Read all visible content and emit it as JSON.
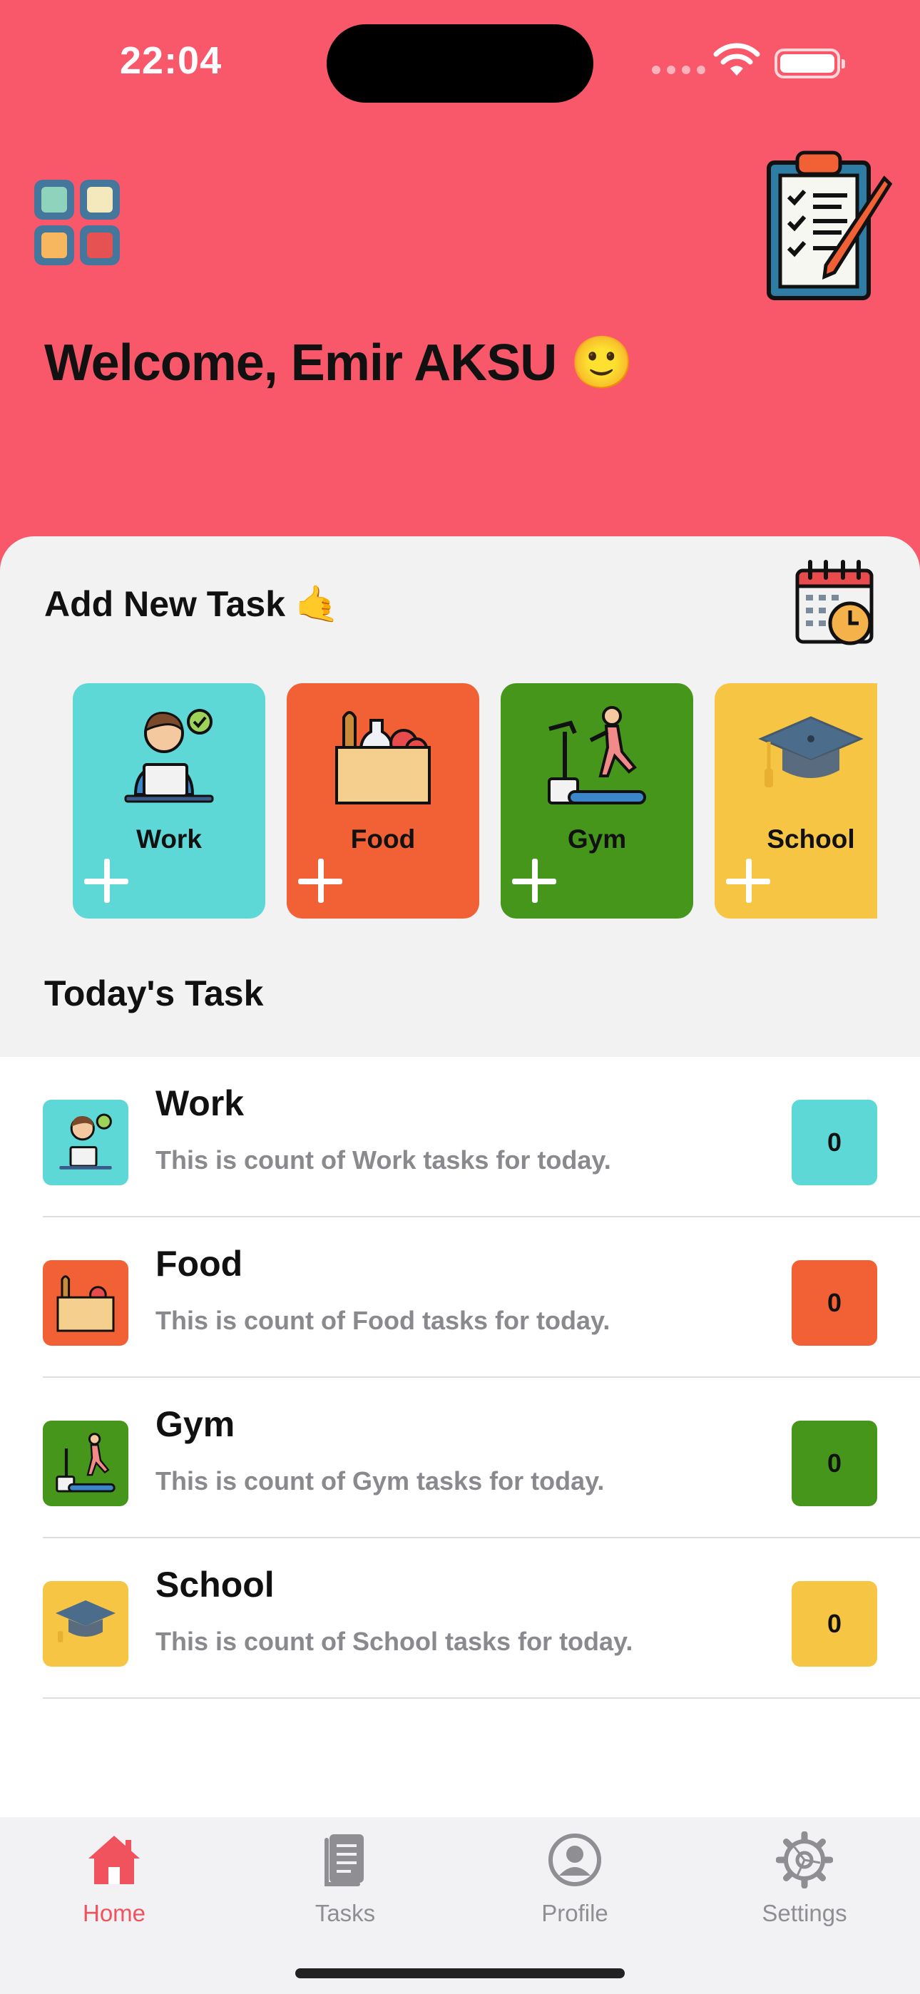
{
  "status_bar": {
    "time": "22:04"
  },
  "header": {
    "welcome": "Welcome, Emir AKSU 🙂"
  },
  "add_task": {
    "title": "Add New Task 🤙",
    "categories": [
      {
        "label": "Work",
        "color": "#5dd8d6"
      },
      {
        "label": "Food",
        "color": "#f26035"
      },
      {
        "label": "Gym",
        "color": "#45961b"
      },
      {
        "label": "School",
        "color": "#f5c543"
      }
    ]
  },
  "today": {
    "title": "Today's Task",
    "rows": [
      {
        "title": "Work",
        "subtitle": "This is count of Work tasks for today.",
        "count": "0",
        "color": "#5dd8d6"
      },
      {
        "title": "Food",
        "subtitle": "This is count of Food tasks for today.",
        "count": "0",
        "color": "#f26035"
      },
      {
        "title": "Gym",
        "subtitle": "This is count of Gym tasks for today.",
        "count": "0",
        "color": "#45961b"
      },
      {
        "title": "School",
        "subtitle": "This is count of School tasks for today.",
        "count": "0",
        "color": "#f5c543"
      }
    ]
  },
  "tabbar": {
    "items": [
      {
        "label": "Home",
        "icon": "house-icon",
        "active": true
      },
      {
        "label": "Tasks",
        "icon": "book-icon",
        "active": false
      },
      {
        "label": "Profile",
        "icon": "person-circle-icon",
        "active": false
      },
      {
        "label": "Settings",
        "icon": "gear-icon",
        "active": false
      }
    ]
  },
  "colors": {
    "header": "#f9576a",
    "accent": "#f0525e",
    "inactive": "#8e8e93"
  }
}
